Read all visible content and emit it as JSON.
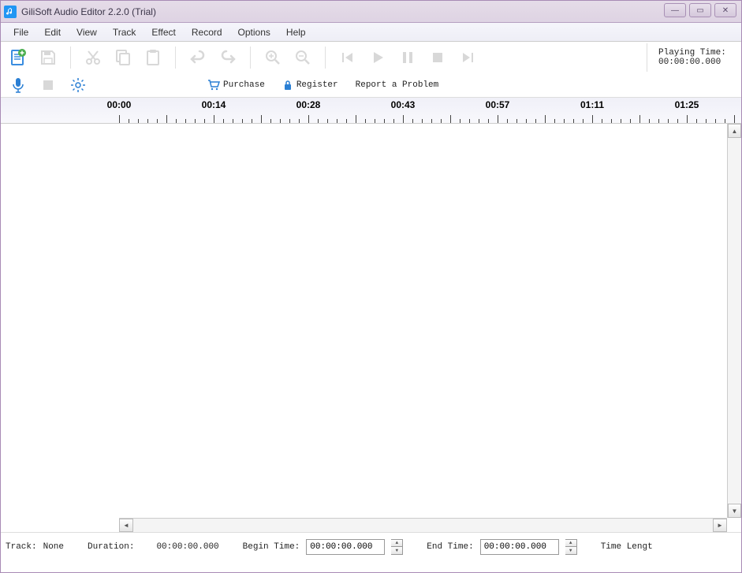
{
  "window": {
    "title": "GiliSoft Audio Editor 2.2.0 (Trial)"
  },
  "menu": {
    "file": "File",
    "edit": "Edit",
    "view": "View",
    "track": "Track",
    "effect": "Effect",
    "record": "Record",
    "options": "Options",
    "help": "Help"
  },
  "toolbar2": {
    "purchase": "Purchase",
    "register": "Register",
    "report": "Report a Problem"
  },
  "playing": {
    "label": "Playing Time:",
    "value": "00:00:00.000"
  },
  "timeline": {
    "labels": [
      "00:00",
      "00:14",
      "00:28",
      "00:43",
      "00:57",
      "01:11",
      "01:25"
    ]
  },
  "status": {
    "track_label": "Track:",
    "track_value": "None",
    "duration_label": "Duration:",
    "duration_value": "00:00:00.000",
    "begin_label": "Begin Time:",
    "begin_value": "00:00:00.000",
    "end_label": "End Time:",
    "end_value": "00:00:00.000",
    "length_label": "Time Lengt"
  }
}
